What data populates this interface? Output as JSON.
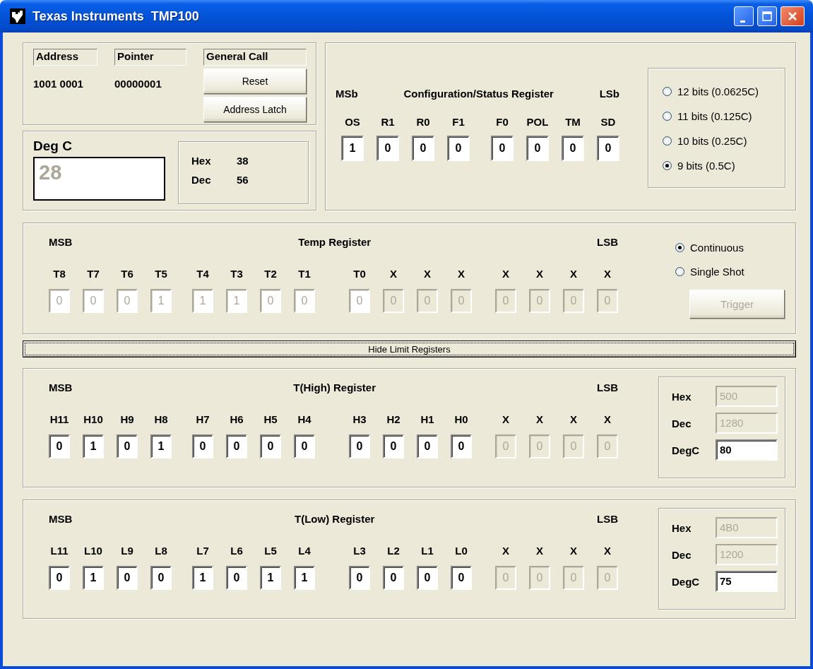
{
  "window": {
    "title": "Texas Instruments  TMP100"
  },
  "address": {
    "heading": "Address",
    "value": "1001 0001"
  },
  "pointer": {
    "heading": "Pointer",
    "value": "00000001"
  },
  "general_call": {
    "heading": "General Call",
    "buttons": [
      {
        "label": "Reset"
      },
      {
        "label": "Address Latch"
      }
    ]
  },
  "temperature": {
    "label": "Deg C",
    "value": "28",
    "hex_label": "Hex",
    "hex": "38",
    "dec_label": "Dec",
    "dec": "56"
  },
  "config": {
    "msb": "MSb",
    "title": "Configuration/Status Register",
    "lsb": "LSb",
    "bits": [
      {
        "label": "OS",
        "value": "1"
      },
      {
        "label": "R1",
        "value": "0"
      },
      {
        "label": "R0",
        "value": "0"
      },
      {
        "label": "F1",
        "value": "0"
      },
      {
        "label": "F0",
        "value": "0"
      },
      {
        "label": "POL",
        "value": "0"
      },
      {
        "label": "TM",
        "value": "0"
      },
      {
        "label": "SD",
        "value": "0"
      }
    ],
    "resolutions": [
      {
        "label": "12 bits (0.0625C)",
        "selected": false
      },
      {
        "label": "11 bits (0.125C)",
        "selected": false
      },
      {
        "label": "10 bits (0.25C)",
        "selected": false
      },
      {
        "label": "9 bits (0.5C)",
        "selected": true
      }
    ]
  },
  "temp_register": {
    "msb": "MSB",
    "title": "Temp Register",
    "lsb": "LSB",
    "bits": [
      {
        "label": "T8",
        "value": "0",
        "kind": "readonly"
      },
      {
        "label": "T7",
        "value": "0",
        "kind": "readonly"
      },
      {
        "label": "T6",
        "value": "0",
        "kind": "readonly"
      },
      {
        "label": "T5",
        "value": "1",
        "kind": "readonly"
      },
      {
        "label": "T4",
        "value": "1",
        "kind": "readonly"
      },
      {
        "label": "T3",
        "value": "1",
        "kind": "readonly"
      },
      {
        "label": "T2",
        "value": "0",
        "kind": "readonly"
      },
      {
        "label": "T1",
        "value": "0",
        "kind": "readonly"
      },
      {
        "label": "T0",
        "value": "0",
        "kind": "readonly"
      },
      {
        "label": "X",
        "value": "0",
        "kind": "disabled"
      },
      {
        "label": "X",
        "value": "0",
        "kind": "disabled"
      },
      {
        "label": "X",
        "value": "0",
        "kind": "disabled"
      },
      {
        "label": "X",
        "value": "0",
        "kind": "disabled"
      },
      {
        "label": "X",
        "value": "0",
        "kind": "disabled"
      },
      {
        "label": "X",
        "value": "0",
        "kind": "disabled"
      },
      {
        "label": "X",
        "value": "0",
        "kind": "disabled"
      }
    ],
    "modes": [
      {
        "label": "Continuous",
        "selected": true
      },
      {
        "label": "Single Shot",
        "selected": false
      }
    ],
    "trigger": {
      "label": "Trigger",
      "disabled": true
    }
  },
  "toggle_button": {
    "label": "Hide Limit Registers",
    "focused": true
  },
  "limit_registers": [
    {
      "msb": "MSB",
      "title": "T(High) Register",
      "lsb": "LSB",
      "bits": [
        {
          "label": "H11",
          "value": "0",
          "kind": "edit"
        },
        {
          "label": "H10",
          "value": "1",
          "kind": "edit"
        },
        {
          "label": "H9",
          "value": "0",
          "kind": "edit"
        },
        {
          "label": "H8",
          "value": "1",
          "kind": "edit"
        },
        {
          "label": "H7",
          "value": "0",
          "kind": "edit"
        },
        {
          "label": "H6",
          "value": "0",
          "kind": "edit"
        },
        {
          "label": "H5",
          "value": "0",
          "kind": "edit"
        },
        {
          "label": "H4",
          "value": "0",
          "kind": "edit"
        },
        {
          "label": "H3",
          "value": "0",
          "kind": "edit"
        },
        {
          "label": "H2",
          "value": "0",
          "kind": "edit"
        },
        {
          "label": "H1",
          "value": "0",
          "kind": "edit"
        },
        {
          "label": "H0",
          "value": "0",
          "kind": "edit"
        },
        {
          "label": "X",
          "value": "0",
          "kind": "disabled"
        },
        {
          "label": "X",
          "value": "0",
          "kind": "disabled"
        },
        {
          "label": "X",
          "value": "0",
          "kind": "disabled"
        },
        {
          "label": "X",
          "value": "0",
          "kind": "disabled"
        }
      ],
      "fields": [
        {
          "label": "Hex",
          "value": "500",
          "disabled": true
        },
        {
          "label": "Dec",
          "value": "1280",
          "disabled": true
        },
        {
          "label": "DegC",
          "value": "80",
          "disabled": false
        }
      ]
    },
    {
      "msb": "MSB",
      "title": "T(Low) Register",
      "lsb": "LSB",
      "bits": [
        {
          "label": "L11",
          "value": "0",
          "kind": "edit"
        },
        {
          "label": "L10",
          "value": "1",
          "kind": "edit"
        },
        {
          "label": "L9",
          "value": "0",
          "kind": "edit"
        },
        {
          "label": "L8",
          "value": "0",
          "kind": "edit"
        },
        {
          "label": "L7",
          "value": "1",
          "kind": "edit"
        },
        {
          "label": "L6",
          "value": "0",
          "kind": "edit"
        },
        {
          "label": "L5",
          "value": "1",
          "kind": "edit"
        },
        {
          "label": "L4",
          "value": "1",
          "kind": "edit"
        },
        {
          "label": "L3",
          "value": "0",
          "kind": "edit"
        },
        {
          "label": "L2",
          "value": "0",
          "kind": "edit"
        },
        {
          "label": "L1",
          "value": "0",
          "kind": "edit"
        },
        {
          "label": "L0",
          "value": "0",
          "kind": "edit"
        },
        {
          "label": "X",
          "value": "0",
          "kind": "disabled"
        },
        {
          "label": "X",
          "value": "0",
          "kind": "disabled"
        },
        {
          "label": "X",
          "value": "0",
          "kind": "disabled"
        },
        {
          "label": "X",
          "value": "0",
          "kind": "disabled"
        }
      ],
      "fields": [
        {
          "label": "Hex",
          "value": "4B0",
          "disabled": true
        },
        {
          "label": "Dec",
          "value": "1200",
          "disabled": true
        },
        {
          "label": "DegC",
          "value": "75",
          "disabled": false
        }
      ]
    }
  ]
}
